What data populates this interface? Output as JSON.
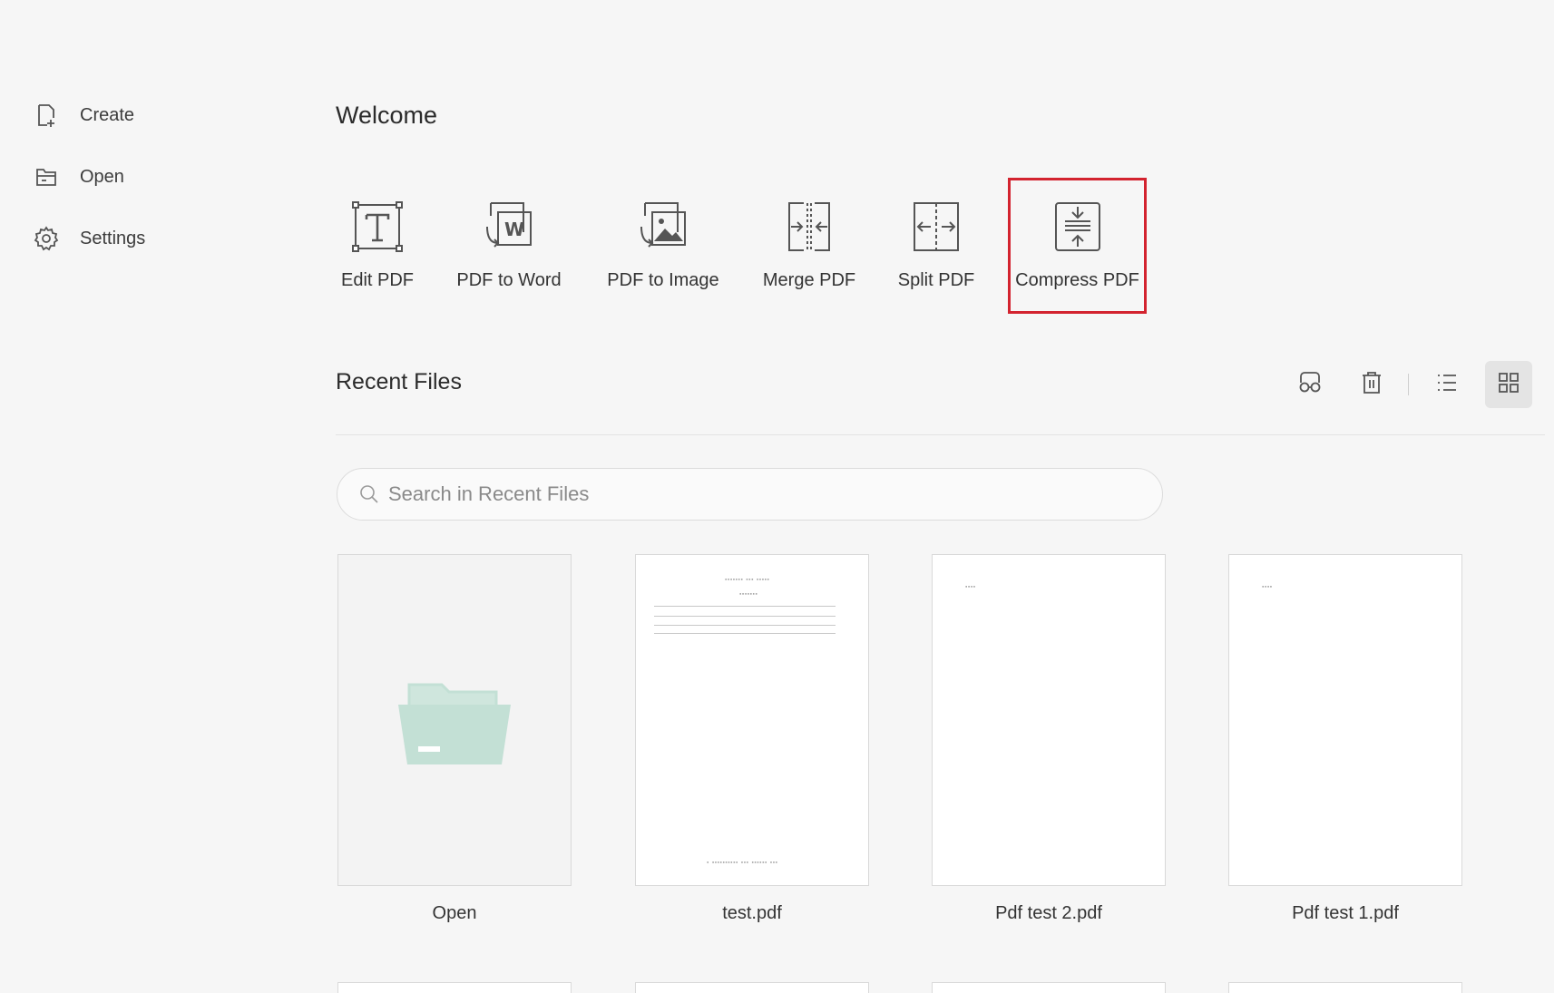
{
  "sidebar": {
    "items": [
      {
        "label": "Create",
        "icon": "create-file-icon"
      },
      {
        "label": "Open",
        "icon": "open-file-icon"
      },
      {
        "label": "Settings",
        "icon": "gear-icon"
      }
    ]
  },
  "main": {
    "title": "Welcome",
    "tools": [
      {
        "label": "Edit PDF",
        "icon": "edit-text-icon"
      },
      {
        "label": "PDF to Word",
        "icon": "pdf-to-word-icon"
      },
      {
        "label": "PDF to Image",
        "icon": "pdf-to-image-icon"
      },
      {
        "label": "Merge PDF",
        "icon": "merge-icon"
      },
      {
        "label": "Split PDF",
        "icon": "split-icon"
      },
      {
        "label": "Compress PDF",
        "icon": "compress-icon",
        "highlighted": true
      }
    ],
    "recent": {
      "title": "Recent Files",
      "toolbar": [
        {
          "icon": "glasses-icon"
        },
        {
          "icon": "trash-icon"
        },
        {
          "icon": "list-view-icon"
        },
        {
          "icon": "grid-view-icon",
          "active": true
        }
      ],
      "search_placeholder": "Search in Recent Files",
      "files": [
        {
          "name": "Open",
          "type": "open"
        },
        {
          "name": "test.pdf",
          "type": "document"
        },
        {
          "name": "Pdf test 2.pdf",
          "type": "document"
        },
        {
          "name": "Pdf test 1.pdf",
          "type": "document"
        }
      ]
    }
  },
  "colors": {
    "background": "#f6f6f6",
    "highlight": "#d3232f",
    "folder": "#c3e0d5"
  }
}
